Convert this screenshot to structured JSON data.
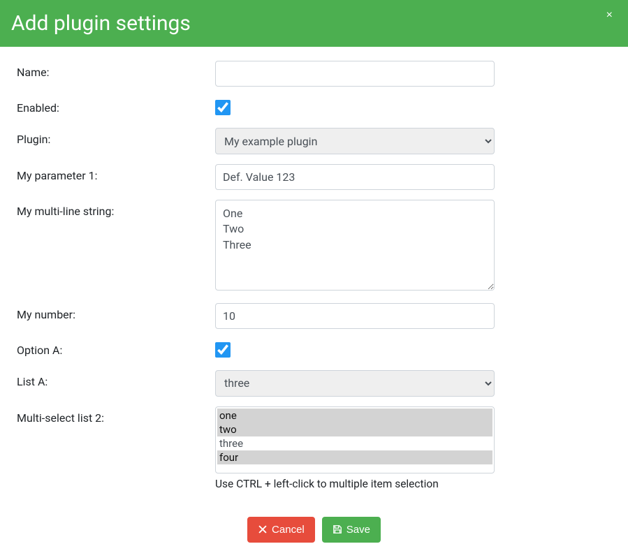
{
  "header": {
    "title": "Add plugin settings",
    "close_icon": "×"
  },
  "form": {
    "name_label": "Name:",
    "name_value": "",
    "enabled_label": "Enabled:",
    "enabled_checked": true,
    "plugin_label": "Plugin:",
    "plugin_selected": "My example plugin",
    "plugin_options": [
      "My example plugin"
    ],
    "param1_label": "My parameter 1:",
    "param1_value": "Def. Value 123",
    "multiline_label": "My multi-line string:",
    "multiline_value": "One\nTwo\nThree",
    "number_label": "My number:",
    "number_value": "10",
    "optiona_label": "Option A:",
    "optiona_checked": true,
    "lista_label": "List A:",
    "lista_selected": "three",
    "lista_options": [
      "three"
    ],
    "multiselect_label": "Multi-select list 2:",
    "multiselect_options": [
      "one",
      "two",
      "three",
      "four"
    ],
    "multiselect_selected": [
      "one",
      "two",
      "four"
    ],
    "multiselect_help": "Use CTRL + left-click to multiple item selection"
  },
  "footer": {
    "cancel_label": "Cancel",
    "save_label": "Save"
  }
}
